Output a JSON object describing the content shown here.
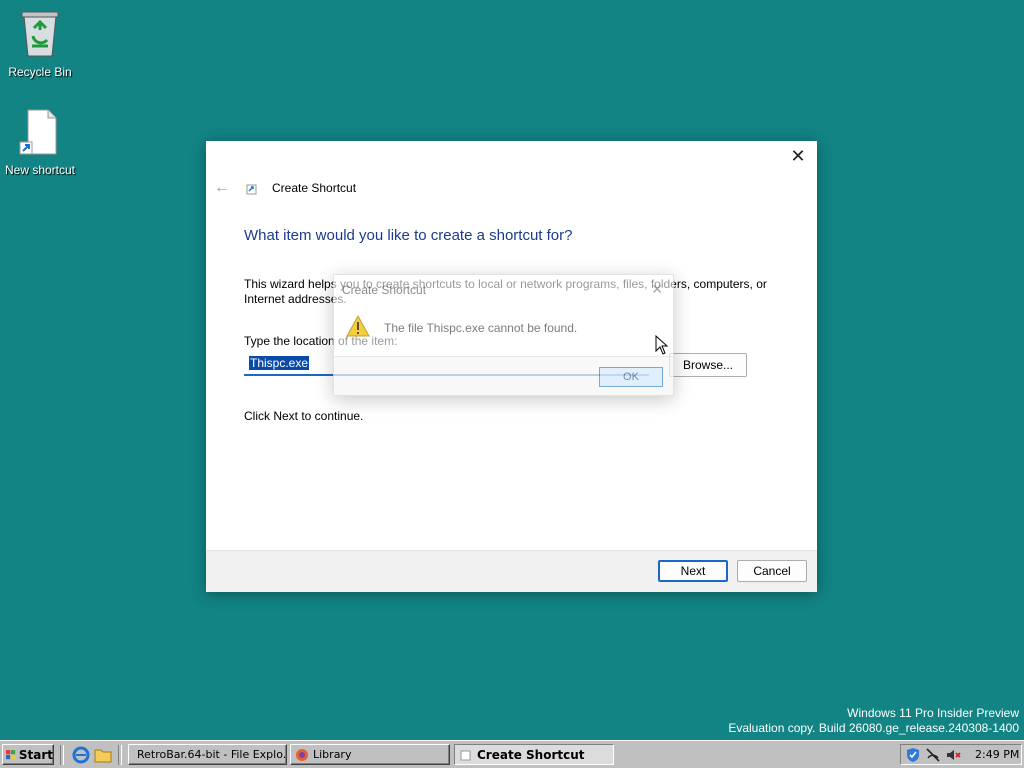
{
  "desktop": {
    "icons": [
      {
        "label": "Recycle Bin",
        "icon": "recycle-bin-icon"
      },
      {
        "label": "New shortcut",
        "icon": "file-shortcut-icon"
      }
    ],
    "watermark": {
      "line1": "Windows 11 Pro Insider Preview",
      "line2": "Evaluation copy. Build 26080.ge_release.240308-1400"
    },
    "background_color": "#128484"
  },
  "wizard": {
    "title": "Create Shortcut",
    "heading": "What item would you like to create a shortcut for?",
    "intro": "This wizard helps you to create shortcuts to local or network programs, files, folders, computers, or Internet addresses.",
    "location_label": "Type the location of the item:",
    "location_value": "Thispc.exe",
    "browse_label": "Browse...",
    "continue_text": "Click Next to continue.",
    "next_label": "Next",
    "cancel_label": "Cancel",
    "close_glyph": "✕",
    "back_glyph": "←"
  },
  "error_dialog": {
    "title": "Create Shortcut",
    "message": "The file Thispc.exe cannot be found.",
    "ok_label": "OK",
    "close_glyph": "✕",
    "icon": "warning-icon"
  },
  "taskbar": {
    "start_label": "Start",
    "tasks": [
      {
        "label": "RetroBar.64-bit - File Explo...",
        "icon": "folder-icon",
        "active": false
      },
      {
        "label": "Library",
        "icon": "firefox-icon",
        "active": false
      },
      {
        "label": "Create Shortcut",
        "icon": "shortcut-wizard-icon",
        "active": true
      }
    ],
    "clock": "2:49 PM",
    "accent_color": "#c0c0c0"
  }
}
